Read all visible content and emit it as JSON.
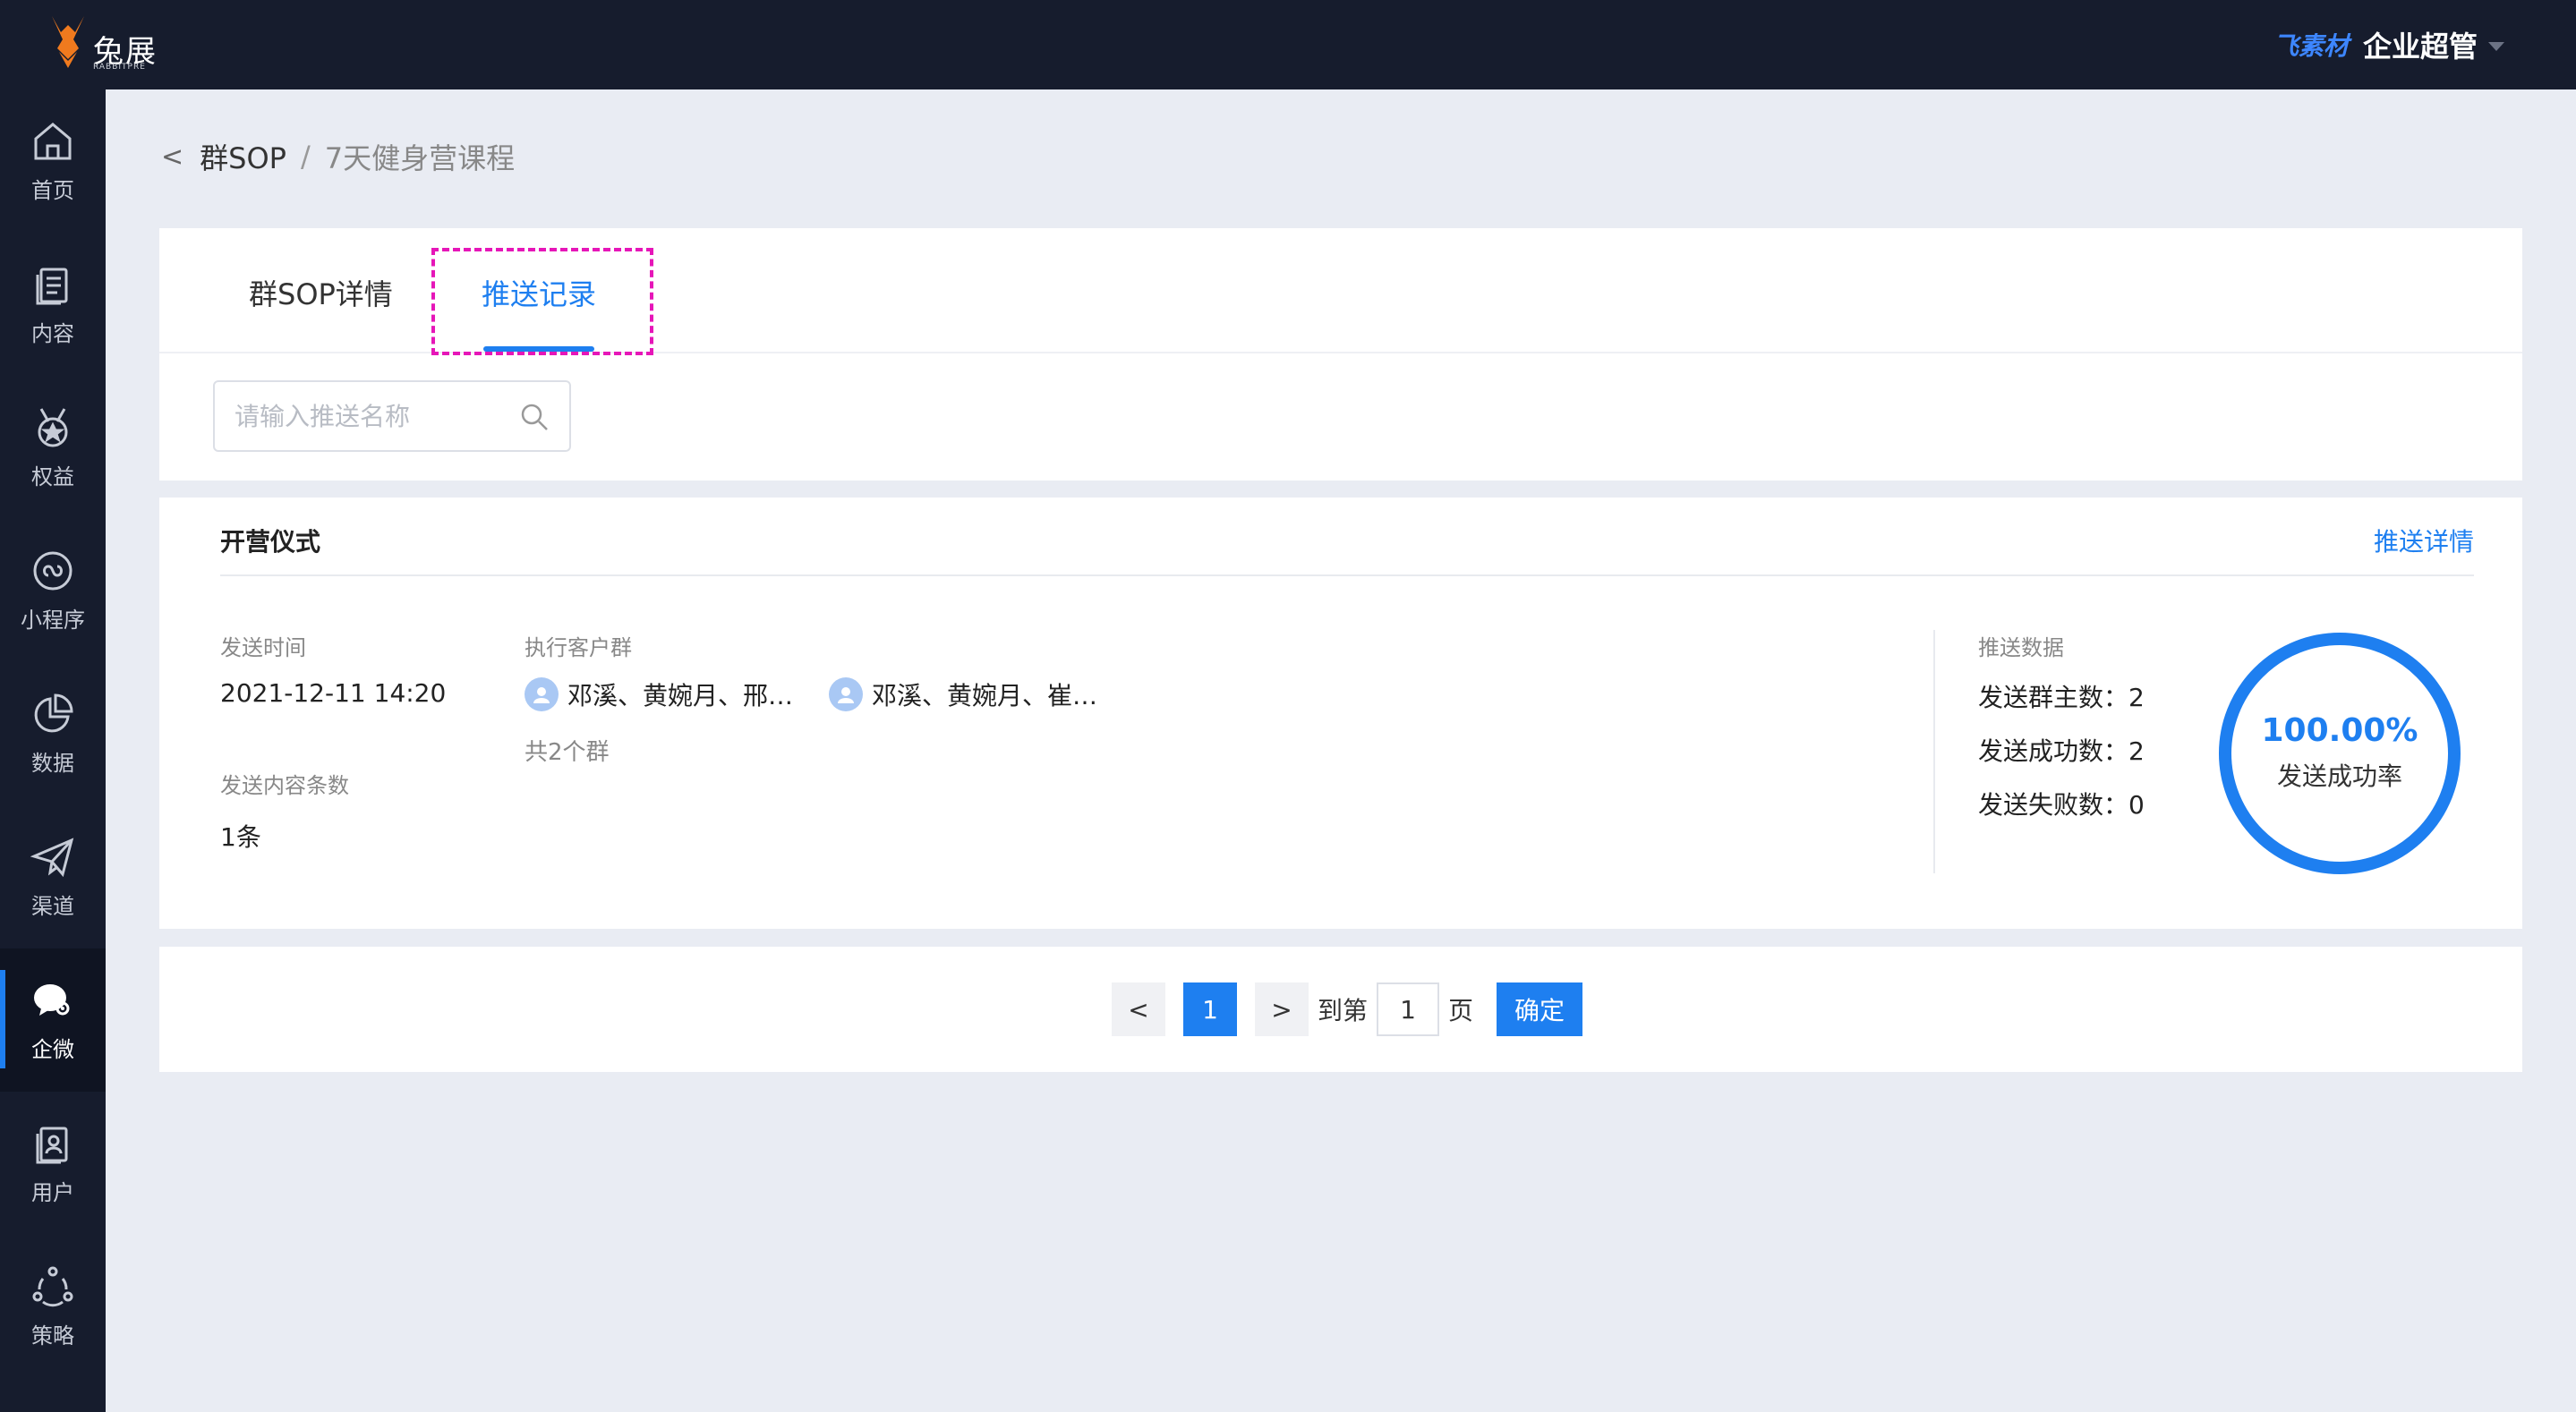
{
  "header": {
    "logo_text": "兔展",
    "logo_sub": "RABBITPRE",
    "brand_mark": "飞素材",
    "user_name": "企业超管"
  },
  "sidebar": {
    "items": [
      {
        "label": "首页",
        "icon": "home-icon"
      },
      {
        "label": "内容",
        "icon": "content-icon"
      },
      {
        "label": "权益",
        "icon": "medal-icon"
      },
      {
        "label": "小程序",
        "icon": "miniprogram-icon"
      },
      {
        "label": "数据",
        "icon": "pie-chart-icon"
      },
      {
        "label": "渠道",
        "icon": "send-icon"
      },
      {
        "label": "企微",
        "icon": "wecom-icon",
        "active": true
      },
      {
        "label": "用户",
        "icon": "user-doc-icon"
      },
      {
        "label": "策略",
        "icon": "strategy-icon"
      }
    ]
  },
  "breadcrumb": {
    "back": "<",
    "parent": "群SOP",
    "separator": "/",
    "current": "7天健身营课程"
  },
  "tabs": {
    "detail": "群SOP详情",
    "records": "推送记录"
  },
  "search": {
    "placeholder": "请输入推送名称"
  },
  "record": {
    "title": "开营仪式",
    "detail_link": "推送详情",
    "send_time_label": "发送时间",
    "send_time": "2021-12-11 14:20",
    "content_count_label": "发送内容条数",
    "content_count": "1条",
    "groups_label": "执行客户群",
    "groups": [
      "邓溪、黄婉月、邢…",
      "邓溪、黄婉月、崔…"
    ],
    "groups_total": "共2个群",
    "stats_label": "推送数据",
    "owners": "发送群主数：2",
    "success": "发送成功数：2",
    "failed": "发送失败数：0",
    "rate_value": "100.00%",
    "rate_fraction": 1.0,
    "rate_label": "发送成功率"
  },
  "pager": {
    "prev": "<",
    "current": "1",
    "next": ">",
    "goto_prefix": "到第",
    "goto_value": "1",
    "goto_suffix": "页",
    "confirm": "确定"
  },
  "colors": {
    "accent": "#1e7ff0",
    "header_bg": "#161c2d",
    "highlight": "#e616b8"
  }
}
